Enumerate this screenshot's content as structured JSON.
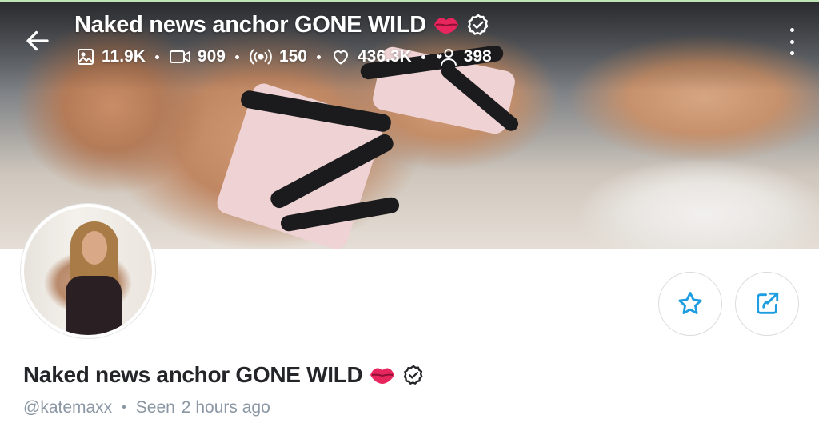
{
  "profile": {
    "display_name": "Naked news anchor GONE WILD",
    "handle": "@katemaxx",
    "seen_label": "Seen",
    "seen_time": "2 hours ago"
  },
  "header": {
    "title": "Naked news anchor GONE WILD",
    "stats": {
      "photos": "11.9K",
      "videos": "909",
      "streams": "150",
      "likes": "436.3K",
      "fans": "398"
    }
  },
  "icons": {
    "back": "arrow-left-icon",
    "lips": "lips-emoji-icon",
    "verified": "verified-badge-icon",
    "more": "more-vertical-icon",
    "photos": "image-icon",
    "videos": "video-icon",
    "streams": "broadcast-icon",
    "likes": "heart-icon",
    "fans": "fans-icon",
    "favorite": "star-icon",
    "share": "share-icon"
  },
  "colors": {
    "accent": "#1e9ee0",
    "name_text": "#242529",
    "muted_text": "#8a96a3",
    "lips": "#e8265e"
  }
}
